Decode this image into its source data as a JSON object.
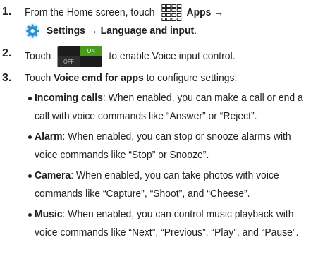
{
  "steps": [
    {
      "number": "1.",
      "line1_text": "From the Home screen, touch",
      "apps_label": "Apps",
      "arrow": "→",
      "settings_label": "Settings",
      "language_label": "Language and input",
      "period": ".",
      "icons": [
        "apps-grid-icon",
        "settings-gear-icon"
      ]
    },
    {
      "number": "2.",
      "touch": "Touch",
      "toggle_on": "ON",
      "toggle_off": "OFF",
      "rest": "to enable Voice input control."
    },
    {
      "number": "3.",
      "touch": "Touch",
      "bold": "Voice cmd for apps",
      "rest": "to configure settings:"
    }
  ],
  "bullets": [
    {
      "term": "Incoming calls",
      "line1": ": When enabled, you can make a call or end a",
      "line2": "call with voice commands like “Answer” or “Reject”."
    },
    {
      "term": "Alarm",
      "line1": ": When enabled, you can stop or snooze alarms with",
      "line2": "voice commands like “Stop” or Snooze”."
    },
    {
      "term": "Camera",
      "line1": ": When enabled, you can take photos with voice",
      "line2": "commands like “Capture”, “Shoot”, and “Cheese”."
    },
    {
      "term": "Music",
      "line1": ": When enabled, you can control music playback with",
      "line2": "voice commands like “Next”, “Previous”, “Play”, and “Pause”."
    }
  ],
  "colors": {
    "text": "#231f20",
    "toggle_on": "#4a9a20",
    "toggle_bg": "#1c1c1c",
    "gear": "#2b8fd6"
  }
}
